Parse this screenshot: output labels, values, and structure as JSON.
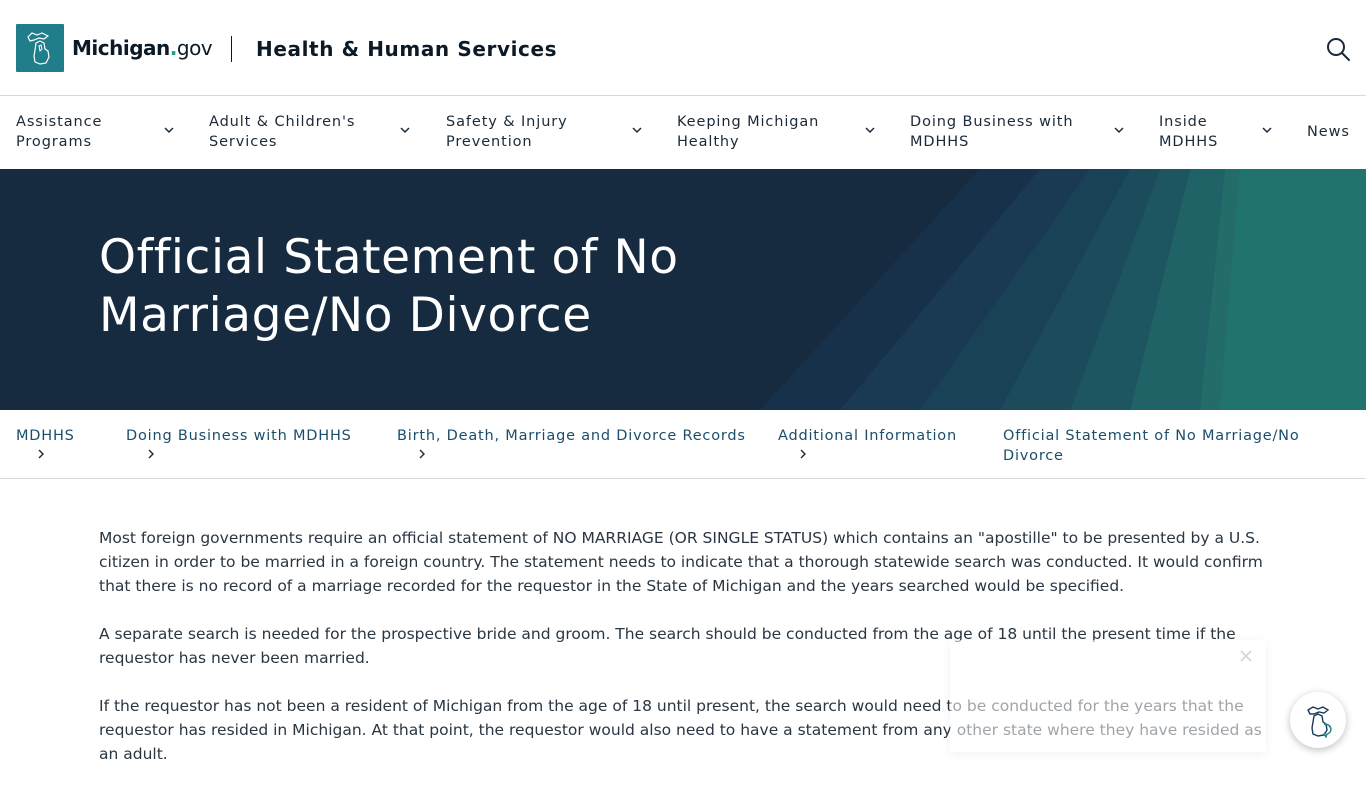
{
  "header": {
    "wordmark_main": "Michigan",
    "wordmark_dot": ".",
    "wordmark_tld": "gov",
    "agency_name": "Health & Human Services",
    "search_icon": "search-icon"
  },
  "nav": {
    "items": [
      {
        "label": "Assistance\nPrograms"
      },
      {
        "label": "Adult & Children's\nServices"
      },
      {
        "label": "Safety & Injury\nPrevention"
      },
      {
        "label": "Keeping Michigan\nHealthy"
      },
      {
        "label": "Doing Business with\nMDHHS"
      },
      {
        "label": "Inside\nMDHHS"
      },
      {
        "label": "News"
      }
    ]
  },
  "hero": {
    "title": "Official Statement of No Marriage/No Divorce"
  },
  "breadcrumb": {
    "items": [
      {
        "label": "MDHHS"
      },
      {
        "label": "Doing Business with MDHHS"
      },
      {
        "label": "Birth, Death, Marriage and Divorce Records"
      },
      {
        "label": "Additional Information"
      },
      {
        "label": "Official Statement of No Marriage/No Divorce"
      }
    ]
  },
  "content": {
    "paragraphs": [
      "Most foreign governments require an official statement of NO MARRIAGE (OR SINGLE STATUS) which contains an \"apostille\" to be presented by a U.S. citizen in order to be married in a foreign country. The statement needs to indicate that a thorough statewide search was conducted. It would confirm that there is no record of a marriage recorded for the requestor in the State of Michigan and the years searched would be specified.",
      "A separate search is needed for the prospective bride and groom. The search should be conducted from the age of 18 until the present time if the requestor has never been married.",
      "If the requestor has not been a resident of Michigan from the age of 18 until present, the search would need to be conducted for the years that the requestor has resided in Michigan. At that point, the requestor would also need to have a statement from any other state where they have resided as an adult."
    ]
  },
  "colors": {
    "brand_teal": "#1f7e8a",
    "hero_navy": "#162b40",
    "link_blue": "#1b4e6b"
  }
}
